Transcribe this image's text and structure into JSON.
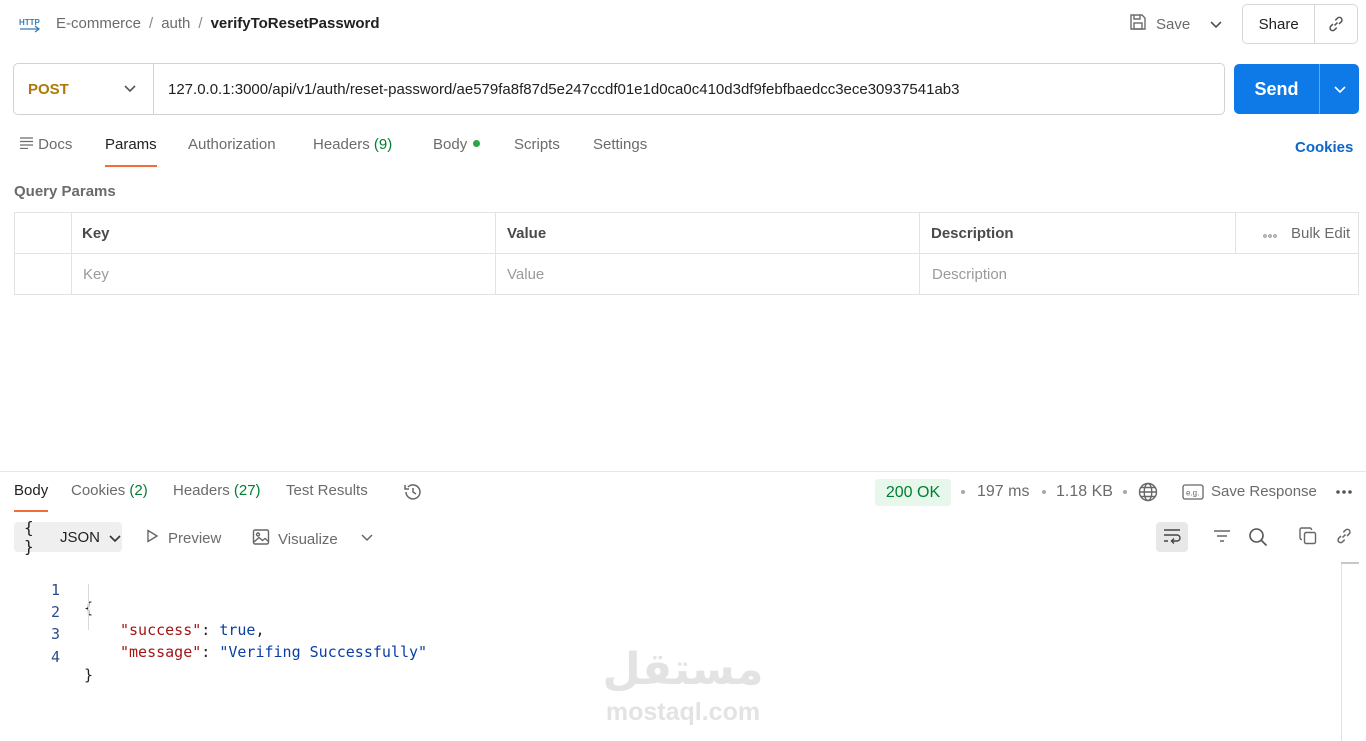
{
  "breadcrumb": {
    "items": [
      "E-commerce",
      "auth"
    ],
    "separator": "/",
    "current": "verifyToResetPassword"
  },
  "toolbar": {
    "save_label": "Save",
    "share_label": "Share"
  },
  "request": {
    "method": "POST",
    "url": "127.0.0.1:3000/api/v1/auth/reset-password/ae579fa8f87d5e247ccdf01e1d0ca0c410d3df9febfbaedcc3ece30937541ab3",
    "send_label": "Send"
  },
  "request_tabs": {
    "docs": "Docs",
    "params": "Params",
    "authorization": "Authorization",
    "headers": "Headers",
    "headers_count": "(9)",
    "body": "Body",
    "scripts": "Scripts",
    "settings": "Settings",
    "cookies": "Cookies"
  },
  "query_params": {
    "title": "Query Params",
    "columns": [
      "Key",
      "Value",
      "Description"
    ],
    "bulk_edit": "Bulk Edit",
    "placeholders": [
      "Key",
      "Value",
      "Description"
    ]
  },
  "response_tabs": {
    "body": "Body",
    "cookies": "Cookies",
    "cookies_count": "(2)",
    "headers": "Headers",
    "headers_count": "(27)",
    "test_results": "Test Results"
  },
  "response_meta": {
    "status": "200 OK",
    "time": "197 ms",
    "size": "1.18 KB",
    "save_response": "Save Response"
  },
  "response_view": {
    "format": "JSON",
    "preview": "Preview",
    "visualize": "Visualize"
  },
  "code_lines": [
    {
      "n": "1",
      "text": "{"
    },
    {
      "n": "2",
      "key": "\"success\"",
      "colon": ": ",
      "value": "true",
      "value_type": "bool",
      "end": ","
    },
    {
      "n": "3",
      "key": "\"message\"",
      "colon": ": ",
      "value": "\"Verifing Successfully\"",
      "value_type": "string",
      "end": ""
    },
    {
      "n": "4",
      "text": "}"
    }
  ],
  "watermark": {
    "arabic": "مستقل",
    "latin": "mostaql.com"
  },
  "colors": {
    "accent": "#0d7ae8",
    "method": "#ad7a03",
    "active_tab": "#f26b3a",
    "status_ok": "#007f31"
  }
}
